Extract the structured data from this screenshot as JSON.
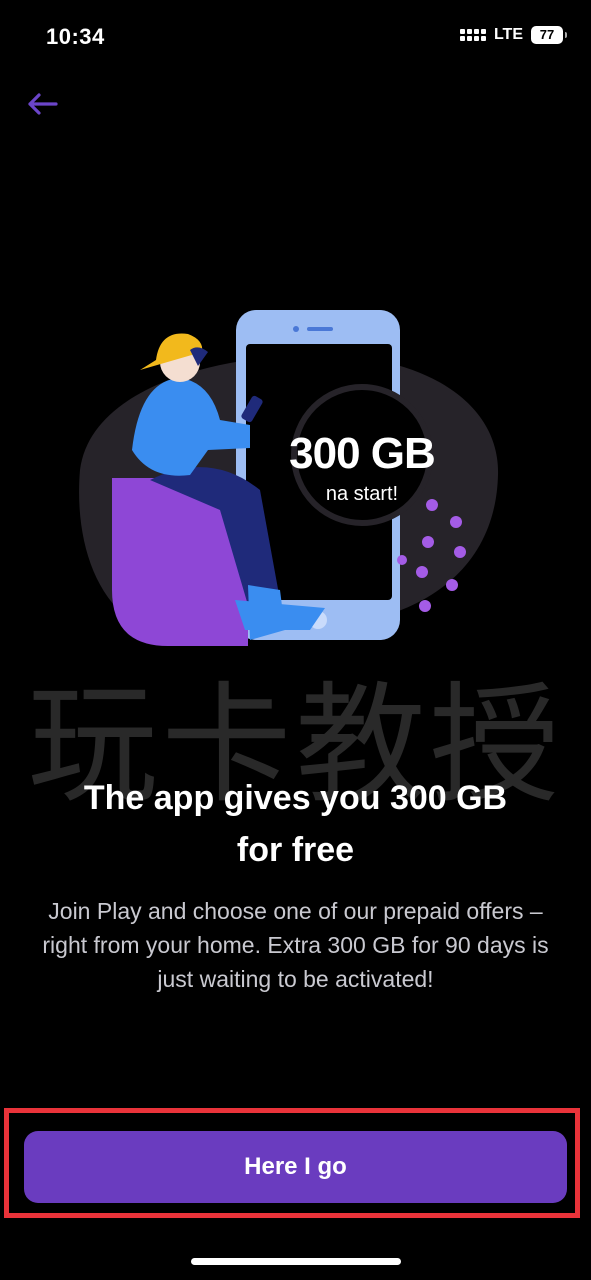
{
  "status_bar": {
    "time": "10:34",
    "network": "LTE",
    "battery": "77"
  },
  "navigation": {
    "back_icon": "back-arrow-icon"
  },
  "hero": {
    "badge_amount": "300 GB",
    "badge_caption": "na start!"
  },
  "watermark": "玩卡教授",
  "content": {
    "headline_line1": "The app gives you 300 GB",
    "headline_line2": "for free",
    "description": "Join Play and choose one of our prepaid offers – right from your home. Extra 300 GB for 90 days is just waiting to be activated!"
  },
  "cta": {
    "label": "Here I go"
  },
  "colors": {
    "background": "#000000",
    "accent": "#6a3cbf",
    "back_arrow": "#6b45c9",
    "highlight_border": "#e9333a"
  }
}
